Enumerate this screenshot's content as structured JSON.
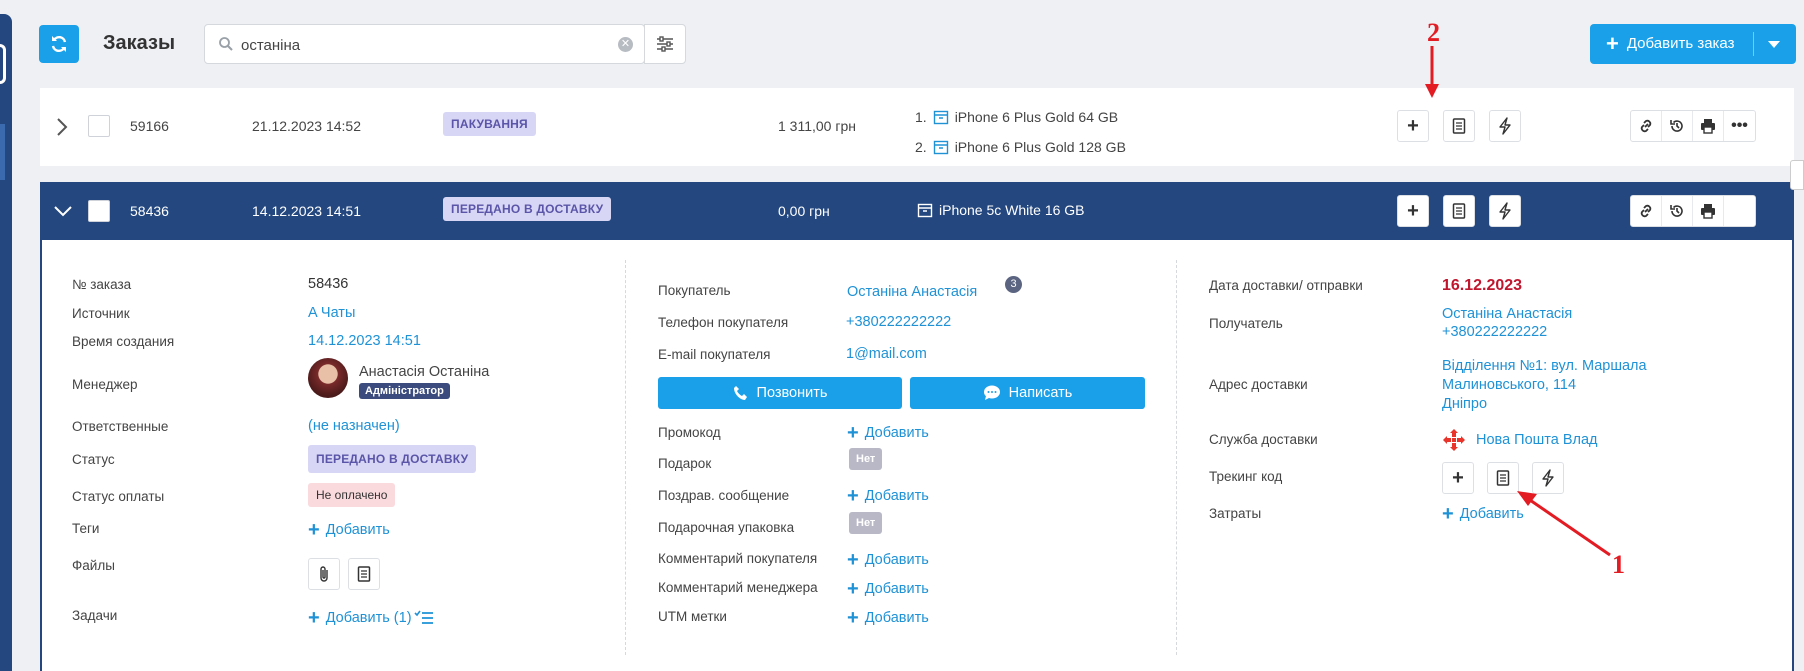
{
  "header": {
    "title": "Заказы",
    "search_value": "останіна",
    "add_order_label": "Добавить заказ"
  },
  "orders": [
    {
      "id": "59166",
      "date": "21.12.2023 14:52",
      "status": "ПАКУВАННЯ",
      "amount": "1 311,00 грн",
      "items": [
        {
          "num": "1.",
          "name": "iPhone 6 Plus Gold 64 GB"
        },
        {
          "num": "2.",
          "name": "iPhone 6 Plus Gold 128 GB"
        }
      ]
    },
    {
      "id": "58436",
      "date": "14.12.2023 14:51",
      "status": "ПЕРЕДАНО В ДОСТАВКУ",
      "amount": "0,00 грн",
      "items": [
        {
          "name": "iPhone 5c White 16 GB"
        }
      ]
    }
  ],
  "detail": {
    "col1": {
      "order_no_label": "№ заказа",
      "order_no": "58436",
      "source_label": "Источник",
      "source": "A Чаты",
      "created_label": "Время создания",
      "created": "14.12.2023 14:51",
      "manager_label": "Менеджер",
      "manager": "Анастасія Останіна",
      "manager_role": "Адміністратор",
      "responsible_label": "Ответственные",
      "responsible": "(не назначен)",
      "status_label": "Статус",
      "status": "ПЕРЕДАНО В ДОСТАВКУ",
      "pay_status_label": "Статус оплаты",
      "pay_status": "Не оплачено",
      "tags_label": "Теги",
      "tags_add": "Добавить",
      "files_label": "Файлы",
      "tasks_label": "Задачи",
      "tasks_add": "Добавить (1)"
    },
    "col2": {
      "buyer_label": "Покупатель",
      "buyer": "Останіна Анастасія",
      "buyer_count": "3",
      "phone_label": "Телефон покупателя",
      "phone": "+380222222222",
      "email_label": "E-mail покупателя",
      "email": "1@mail.com",
      "call_label": "Позвонить",
      "write_label": "Написать",
      "promo_label": "Промокод",
      "promo_add": "Добавить",
      "gift_label": "Подарок",
      "gift": "Нет",
      "greeting_label": "Поздрав. сообщение",
      "greeting_add": "Добавить",
      "wrap_label": "Подарочная упаковка",
      "wrap": "Нет",
      "buyer_comment_label": "Комментарий покупателя",
      "buyer_comment_add": "Добавить",
      "manager_comment_label": "Комментарий менеджера",
      "manager_comment_add": "Добавить",
      "utm_label": "UTM метки",
      "utm_add": "Добавить"
    },
    "col3": {
      "delivery_date_label": "Дата доставки/ отправки",
      "delivery_date": "16.12.2023",
      "recipient_label": "Получатель",
      "recipient_name": "Останіна Анастасія",
      "recipient_phone": "+380222222222",
      "address_label": "Адрес доставки",
      "address_line1": "Відділення №1: вул. Маршала",
      "address_line2": "Малиновського, 114",
      "address_line3": "Дніпро",
      "service_label": "Служба доставки",
      "service": "Нова Пошта Влад",
      "tracking_label": "Трекинг код",
      "costs_label": "Затраты",
      "costs_add": "Добавить"
    }
  },
  "annotations": {
    "one": "1",
    "two": "2"
  },
  "colors": {
    "accent": "#1aa0e9",
    "navy": "#23477e",
    "link": "#1f92d6",
    "annotation": "#e31b23",
    "date_red": "#c0172f"
  },
  "icons": [
    "refresh-icon",
    "search-icon",
    "clear-icon",
    "filter-icon",
    "plus-icon",
    "document-icon",
    "bolt-icon",
    "link-icon",
    "history-icon",
    "print-icon",
    "more-icon",
    "box-icon",
    "phone-icon",
    "chat-icon",
    "paperclip-icon",
    "task-list-icon",
    "nova-poshta-logo"
  ]
}
